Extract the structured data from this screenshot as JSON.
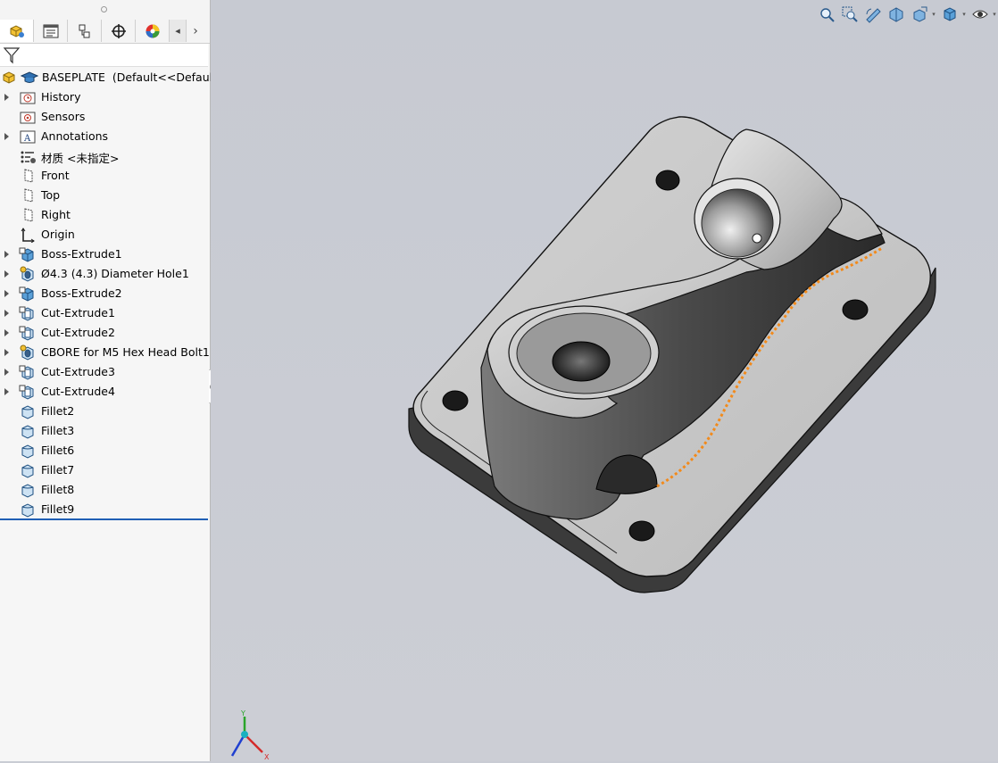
{
  "tabs": [
    {
      "icon": "feature-manager-icon",
      "active": true
    },
    {
      "icon": "property-manager-icon",
      "active": false
    },
    {
      "icon": "configuration-manager-icon",
      "active": false
    },
    {
      "icon": "dimxpert-manager-icon",
      "active": false
    },
    {
      "icon": "display-manager-icon",
      "active": false
    }
  ],
  "tree": {
    "root": {
      "name": "BASEPLATE",
      "config": "(Default<<Default>"
    },
    "items": [
      {
        "label": "History",
        "icon": "history-folder-icon",
        "expandable": true
      },
      {
        "label": "Sensors",
        "icon": "sensors-folder-icon",
        "expandable": false
      },
      {
        "label": "Annotations",
        "icon": "annotations-folder-icon",
        "expandable": true
      },
      {
        "label": "材质 <未指定>",
        "icon": "material-icon",
        "expandable": false
      },
      {
        "label": "Front",
        "icon": "plane-icon",
        "expandable": false
      },
      {
        "label": "Top",
        "icon": "plane-icon",
        "expandable": false
      },
      {
        "label": "Right",
        "icon": "plane-icon",
        "expandable": false
      },
      {
        "label": "Origin",
        "icon": "origin-icon",
        "expandable": false
      },
      {
        "label": "Boss-Extrude1",
        "icon": "boss-extrude-icon",
        "expandable": true
      },
      {
        "label": "Ø4.3 (4.3) Diameter Hole1",
        "icon": "hole-wizard-icon",
        "expandable": true
      },
      {
        "label": "Boss-Extrude2",
        "icon": "boss-extrude-icon",
        "expandable": true
      },
      {
        "label": "Cut-Extrude1",
        "icon": "cut-extrude-icon",
        "expandable": true
      },
      {
        "label": "Cut-Extrude2",
        "icon": "cut-extrude-icon",
        "expandable": true
      },
      {
        "label": "CBORE for M5 Hex Head Bolt1",
        "icon": "hole-wizard-icon",
        "expandable": true
      },
      {
        "label": "Cut-Extrude3",
        "icon": "cut-extrude-icon",
        "expandable": true
      },
      {
        "label": "Cut-Extrude4",
        "icon": "cut-extrude-icon",
        "expandable": true
      },
      {
        "label": "Fillet2",
        "icon": "fillet-icon",
        "expandable": false
      },
      {
        "label": "Fillet3",
        "icon": "fillet-icon",
        "expandable": false
      },
      {
        "label": "Fillet6",
        "icon": "fillet-icon",
        "expandable": false
      },
      {
        "label": "Fillet7",
        "icon": "fillet-icon",
        "expandable": false
      },
      {
        "label": "Fillet8",
        "icon": "fillet-icon",
        "expandable": false
      },
      {
        "label": "Fillet9",
        "icon": "fillet-icon",
        "expandable": false
      }
    ]
  },
  "view_toolbar": [
    "zoom-to-fit-icon",
    "zoom-to-area-icon",
    "previous-view-icon",
    "section-view-icon",
    "view-orientation-icon",
    "display-style-icon",
    "hide-show-items-icon"
  ],
  "triad": {
    "x": "X",
    "y": "Y",
    "z": "Z"
  },
  "colors": {
    "selection_edge": "#f28a1b",
    "rollback_bar": "#1f5fb5",
    "viewport_bg": "#c9ccd4"
  }
}
